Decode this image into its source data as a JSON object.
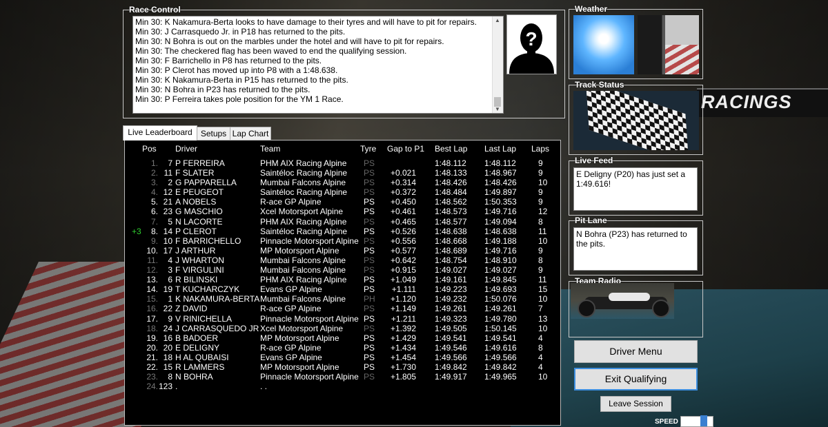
{
  "race_control": {
    "title": "Race Control",
    "messages": [
      "Min 30: K Nakamura-Berta looks to have damage to their tyres and will have to pit for repairs.",
      "Min 30: J Carrasquedo Jr. in P18 has returned to the pits.",
      "Min 30: N Bohra is out on the marbles under the hotel and will have to pit for repairs.",
      "Min 30: The checkered flag has been waved to end the qualifying session.",
      "Min 30: F Barrichello in P8 has returned to the pits.",
      "Min 30: P Clerot has moved up into P8 with a 1:48.638.",
      "Min 30: K Nakamura-Berta in P15 has returned to the pits.",
      "Min 30: N Bohra in P23 has returned to the pits.",
      "Min 30: P Ferreira takes pole position for the YM 1 Race."
    ],
    "portrait_symbol": "?"
  },
  "tabs": [
    "Live Leaderboard",
    "Setups",
    "Lap Chart"
  ],
  "leaderboard": {
    "headers": {
      "pos": "Pos",
      "driver": "Driver",
      "team": "Team",
      "tyre": "Tyre",
      "gap": "Gap to P1",
      "best": "Best Lap",
      "last": "Last Lap",
      "laps": "Laps"
    },
    "rows": [
      {
        "chg": "",
        "pos": "1.",
        "num": "7",
        "driver": "P  FERREIRA",
        "team": "PHM AIX Racing Alpine",
        "tyre": "PS",
        "gap": "",
        "best": "1:48.112",
        "last": "1:48.112",
        "laps": "9",
        "dim": true
      },
      {
        "chg": "",
        "pos": "2.",
        "num": "11",
        "driver": "F  SLATER",
        "team": "Saintéloc Racing Alpine",
        "tyre": "PS",
        "gap": "+0.021",
        "best": "1:48.133",
        "last": "1:48.967",
        "laps": "9",
        "dim": true
      },
      {
        "chg": "",
        "pos": "3.",
        "num": "2",
        "driver": "G  PAPPARELLA",
        "team": "Mumbai Falcons Alpine",
        "tyre": "PS",
        "gap": "+0.314",
        "best": "1:48.426",
        "last": "1:48.426",
        "laps": "10",
        "dim": true
      },
      {
        "chg": "",
        "pos": "4.",
        "num": "12",
        "driver": "E  PEUGEOT",
        "team": "Saintéloc Racing Alpine",
        "tyre": "PS",
        "gap": "+0.372",
        "best": "1:48.484",
        "last": "1:49.897",
        "laps": "9",
        "dim": true
      },
      {
        "chg": "",
        "pos": "5.",
        "num": "21",
        "driver": "A  NOBELS",
        "team": "R-ace GP Alpine",
        "tyre": "PS",
        "gap": "+0.450",
        "best": "1:48.562",
        "last": "1:50.353",
        "laps": "9",
        "dim": false
      },
      {
        "chg": "",
        "pos": "6.",
        "num": "23",
        "driver": "G  MASCHIO",
        "team": "Xcel Motorsport Alpine",
        "tyre": "PS",
        "gap": "+0.461",
        "best": "1:48.573",
        "last": "1:49.716",
        "laps": "12",
        "dim": false
      },
      {
        "chg": "",
        "pos": "7.",
        "num": "5",
        "driver": "N  LACORTE",
        "team": "PHM AIX Racing Alpine",
        "tyre": "PS",
        "gap": "+0.465",
        "best": "1:48.577",
        "last": "1:49.094",
        "laps": "8",
        "dim": true
      },
      {
        "chg": "+3",
        "pos": "8.",
        "num": "14",
        "driver": "P  CLEROT",
        "team": "Saintéloc Racing Alpine",
        "tyre": "PS",
        "gap": "+0.526",
        "best": "1:48.638",
        "last": "1:48.638",
        "laps": "11",
        "dim": false
      },
      {
        "chg": "",
        "pos": "9.",
        "num": "10",
        "driver": "F  BARRICHELLO",
        "team": "Pinnacle Motorsport Alpine",
        "tyre": "PS",
        "gap": "+0.556",
        "best": "1:48.668",
        "last": "1:49.188",
        "laps": "10",
        "dim": true
      },
      {
        "chg": "",
        "pos": "10.",
        "num": "17",
        "driver": "J  ARTHUR",
        "team": "MP Motorsport Alpine",
        "tyre": "PS",
        "gap": "+0.577",
        "best": "1:48.689",
        "last": "1:49.716",
        "laps": "9",
        "dim": false
      },
      {
        "chg": "",
        "pos": "11.",
        "num": "4",
        "driver": "J  WHARTON",
        "team": "Mumbai Falcons Alpine",
        "tyre": "PS",
        "gap": "+0.642",
        "best": "1:48.754",
        "last": "1:48.910",
        "laps": "8",
        "dim": true
      },
      {
        "chg": "",
        "pos": "12.",
        "num": "3",
        "driver": "F  VIRGULINI",
        "team": "Mumbai Falcons Alpine",
        "tyre": "PS",
        "gap": "+0.915",
        "best": "1:49.027",
        "last": "1:49.027",
        "laps": "9",
        "dim": true
      },
      {
        "chg": "",
        "pos": "13.",
        "num": "6",
        "driver": "R  BILINSKI",
        "team": "PHM AIX Racing Alpine",
        "tyre": "PS",
        "gap": "+1.049",
        "best": "1:49.161",
        "last": "1:49.845",
        "laps": "11",
        "dim": false
      },
      {
        "chg": "",
        "pos": "14.",
        "num": "19",
        "driver": "T  KUCHARCZYK",
        "team": "Evans GP Alpine",
        "tyre": "PS",
        "gap": "+1.111",
        "best": "1:49.223",
        "last": "1:49.693",
        "laps": "15",
        "dim": false
      },
      {
        "chg": "",
        "pos": "15.",
        "num": "1",
        "driver": "K  NAKAMURA-BERTA",
        "team": "Mumbai Falcons Alpine",
        "tyre": "PH",
        "gap": "+1.120",
        "best": "1:49.232",
        "last": "1:50.076",
        "laps": "10",
        "dim": true
      },
      {
        "chg": "",
        "pos": "16.",
        "num": "22",
        "driver": "Z  DAVID",
        "team": "R-ace GP Alpine",
        "tyre": "PS",
        "gap": "+1.149",
        "best": "1:49.261",
        "last": "1:49.261",
        "laps": "7",
        "dim": true
      },
      {
        "chg": "",
        "pos": "17.",
        "num": "9",
        "driver": "V  RINICHELLA",
        "team": "Pinnacle Motorsport Alpine",
        "tyre": "PS",
        "gap": "+1.211",
        "best": "1:49.323",
        "last": "1:49.780",
        "laps": "13",
        "dim": false
      },
      {
        "chg": "",
        "pos": "18.",
        "num": "24",
        "driver": "J  CARRASQUEDO JR",
        "team": "Xcel Motorsport Alpine",
        "tyre": "PS",
        "gap": "+1.392",
        "best": "1:49.505",
        "last": "1:50.145",
        "laps": "10",
        "dim": true
      },
      {
        "chg": "",
        "pos": "19.",
        "num": "16",
        "driver": "B  BADOER",
        "team": "MP Motorsport Alpine",
        "tyre": "PS",
        "gap": "+1.429",
        "best": "1:49.541",
        "last": "1:49.541",
        "laps": "4",
        "dim": false
      },
      {
        "chg": "",
        "pos": "20.",
        "num": "20",
        "driver": "E  DELIGNY",
        "team": "R-ace GP Alpine",
        "tyre": "PS",
        "gap": "+1.434",
        "best": "1:49.546",
        "last": "1:49.616",
        "laps": "8",
        "dim": false
      },
      {
        "chg": "",
        "pos": "21.",
        "num": "18",
        "driver": "H  AL QUBAISI",
        "team": "Evans GP Alpine",
        "tyre": "PS",
        "gap": "+1.454",
        "best": "1:49.566",
        "last": "1:49.566",
        "laps": "4",
        "dim": false
      },
      {
        "chg": "",
        "pos": "22.",
        "num": "15",
        "driver": "R  LAMMERS",
        "team": "MP Motorsport Alpine",
        "tyre": "PS",
        "gap": "+1.730",
        "best": "1:49.842",
        "last": "1:49.842",
        "laps": "4",
        "dim": false
      },
      {
        "chg": "",
        "pos": "23.",
        "num": "8",
        "driver": "N  BOHRA",
        "team": "Pinnacle Motorsport Alpine",
        "tyre": "PS",
        "gap": "+1.805",
        "best": "1:49.917",
        "last": "1:49.965",
        "laps": "10",
        "dim": true
      },
      {
        "chg": "",
        "pos": "24.",
        "num": "123",
        "driver": ".",
        "team": ". .",
        "tyre": "",
        "gap": "",
        "best": "",
        "last": "",
        "laps": "",
        "dim": true
      }
    ]
  },
  "weather": {
    "title": "Weather"
  },
  "track_status": {
    "title": "Track Status"
  },
  "live_feed": {
    "title": "Live Feed",
    "text": "E Deligny (P20) has just set a 1:49.616!"
  },
  "pit_lane": {
    "title": "Pit Lane",
    "text": "N Bohra (P23) has returned to the pits."
  },
  "team_radio": {
    "title": "Team Radio"
  },
  "buttons": {
    "driver_menu": "Driver Menu",
    "exit_qualifying": "Exit Qualifying",
    "leave_session": "Leave Session"
  },
  "speed": {
    "label": "SPEED"
  },
  "background": {
    "sign_text": "RACINGS"
  }
}
